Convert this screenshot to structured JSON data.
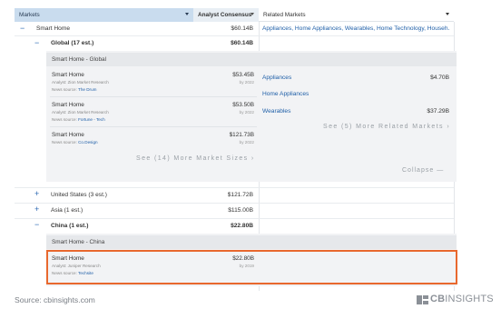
{
  "header": {
    "markets": "Markets",
    "consensus": "Analyst Consensus",
    "related": "Related Markets"
  },
  "rows": {
    "smart_home": {
      "label": "Smart Home",
      "value": "$60.14B",
      "toggle": "−"
    },
    "global": {
      "label": "Global (17 est.)",
      "value": "$60.14B",
      "toggle": "−"
    },
    "us": {
      "label": "United States (3 est.)",
      "value": "$121.72B",
      "toggle": "+"
    },
    "asia": {
      "label": "Asia (1 est.)",
      "value": "$115.00B",
      "toggle": "+"
    },
    "china": {
      "label": "China (1 est.)",
      "value": "$22.80B",
      "toggle": "−"
    }
  },
  "related_summary": "Appliances, Home Appliances, Wearables, Home Technology, Househ...",
  "global_panel": {
    "title": "Smart Home - Global",
    "cards": [
      {
        "name": "Smart Home",
        "analyst": "Analyst: Zion Market Research",
        "source_label": "News source:",
        "source": "The Drum",
        "value": "$53.45B",
        "date": "by 2022"
      },
      {
        "name": "Smart Home",
        "analyst": "Analyst: Zion Market Research",
        "source_label": "News source:",
        "source": "Fortune - Tech",
        "value": "$53.50B",
        "date": "by 2022"
      },
      {
        "name": "Smart Home",
        "analyst": "Analyst: Zion Market Research",
        "source_label": "News source:",
        "source": "Co.Design",
        "value": "$121.73B",
        "date": "by 2022"
      }
    ],
    "more_sizes": "See (14) More Market Sizes",
    "related": [
      {
        "name": "Appliances",
        "value": "$4.70B"
      },
      {
        "name": "Home Appliances",
        "value": ""
      },
      {
        "name": "Wearables",
        "value": "$37.29B"
      }
    ],
    "more_related": "See (5) More Related Markets",
    "collapse": "Collapse"
  },
  "china_panel": {
    "title": "Smart Home - China",
    "card": {
      "name": "Smart Home",
      "analyst": "Analyst: Juniper Research",
      "source_label": "News source:",
      "source": "Techsite",
      "value": "$22.80B",
      "date": "by 2019"
    }
  },
  "footer": {
    "source": "Source: cbinsights.com",
    "brand": "CBINSIGHTS"
  },
  "colors": {
    "accent": "#1f5fa8",
    "highlight": "#e8682e",
    "header_bg": "#c9dcee"
  }
}
